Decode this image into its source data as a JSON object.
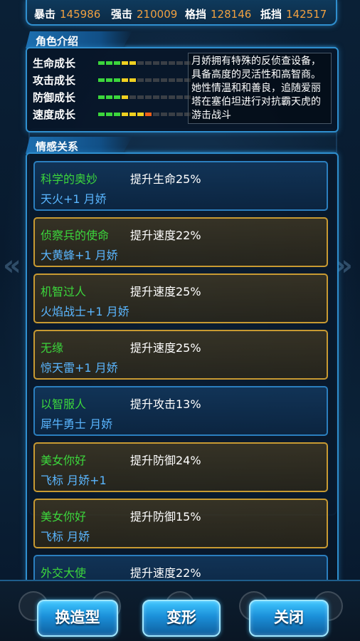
{
  "stats": [
    {
      "label": "暴击",
      "value": "145986"
    },
    {
      "label": "强击",
      "value": "210009"
    },
    {
      "label": "格挡",
      "value": "128146"
    },
    {
      "label": "抵挡",
      "value": "142517"
    }
  ],
  "intro": {
    "header": "角色介绍",
    "growth": [
      {
        "label": "生命成长",
        "level": 5
      },
      {
        "label": "攻击成长",
        "level": 5
      },
      {
        "label": "防御成长",
        "level": 4
      },
      {
        "label": "速度成长",
        "level": 7
      }
    ],
    "growth_max": 12,
    "description": "月娇拥有特殊的反侦查设备，具备高度的灵活性和高智商。她性情温和和善良，追随爱丽塔在塞伯坦进行对抗霸天虎的游击战斗",
    "colors": {
      "bar_green": "#3cd63c",
      "bar_yellow": "#f0d020",
      "bar_orange": "#f06018",
      "bar_empty": "#3a3f46"
    }
  },
  "relations": {
    "header": "情感关系",
    "items": [
      {
        "title": "科学的奥妙",
        "effect": "提升生命25%",
        "members": "天火+1 月娇",
        "style": "blue"
      },
      {
        "title": "侦察兵的使命",
        "effect": "提升速度22%",
        "members": "大黄蜂+1 月娇",
        "style": "gold"
      },
      {
        "title": "机智过人",
        "effect": "提升速度25%",
        "members": "火焰战士+1 月娇",
        "style": "gold"
      },
      {
        "title": "无缘",
        "effect": "提升速度25%",
        "members": "惊天雷+1 月娇",
        "style": "gold"
      },
      {
        "title": "以智服人",
        "effect": "提升攻击13%",
        "members": "犀牛勇士 月娇",
        "style": "blue"
      },
      {
        "title": "美女你好",
        "effect": "提升防御24%",
        "members": "飞标 月娇+1",
        "style": "gold"
      },
      {
        "title": "美女你好",
        "effect": "提升防御15%",
        "members": "飞标 月娇",
        "style": "gold"
      },
      {
        "title": "外交大使",
        "effect": "提升速度22%",
        "members": "",
        "style": "blue"
      }
    ]
  },
  "buttons": {
    "remodel": "换造型",
    "transform": "变形",
    "close": "关闭"
  }
}
